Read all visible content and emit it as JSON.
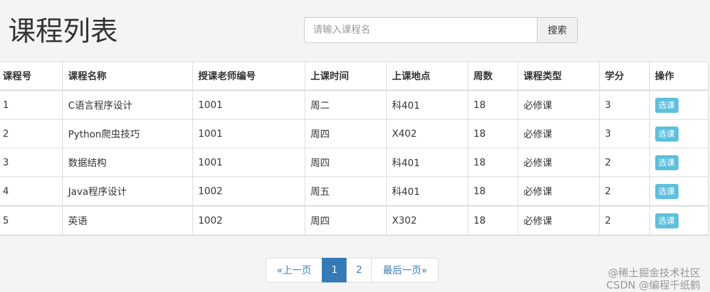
{
  "header": {
    "title": "课程列表"
  },
  "search": {
    "placeholder": "请输入课程名",
    "value": "",
    "button_label": "搜索"
  },
  "table": {
    "columns": [
      "课程号",
      "课程名称",
      "授课老师编号",
      "上课时间",
      "上课地点",
      "周数",
      "课程类型",
      "学分",
      "操作"
    ],
    "rows": [
      {
        "id": "1",
        "name": "C语言程序设计",
        "teacher": "1001",
        "time": "周二",
        "place": "科401",
        "weeks": "18",
        "type": "必修课",
        "credit": "3",
        "action": "选课"
      },
      {
        "id": "2",
        "name": "Python爬虫技巧",
        "teacher": "1001",
        "time": "周四",
        "place": "X402",
        "weeks": "18",
        "type": "必修课",
        "credit": "3",
        "action": "选课"
      },
      {
        "id": "3",
        "name": "数据结构",
        "teacher": "1001",
        "time": "周四",
        "place": "科401",
        "weeks": "18",
        "type": "必修课",
        "credit": "2",
        "action": "选课"
      },
      {
        "id": "4",
        "name": "Java程序设计",
        "teacher": "1002",
        "time": "周五",
        "place": "科401",
        "weeks": "18",
        "type": "必修课",
        "credit": "2",
        "action": "选课"
      },
      {
        "id": "5",
        "name": "英语",
        "teacher": "1002",
        "time": "周四",
        "place": "X302",
        "weeks": "18",
        "type": "必修课",
        "credit": "2",
        "action": "选课"
      }
    ]
  },
  "pagination": {
    "prev_label": "«上一页",
    "pages": [
      "1",
      "2"
    ],
    "active_page": "1",
    "last_label": "最后一页»"
  },
  "watermark": {
    "text": "@稀土掘金技术社区\nCSDN @编程千纸鹤"
  },
  "colors": {
    "accent": "#337ab7",
    "select_button": "#5bc0de",
    "background": "#f4f4f4"
  }
}
